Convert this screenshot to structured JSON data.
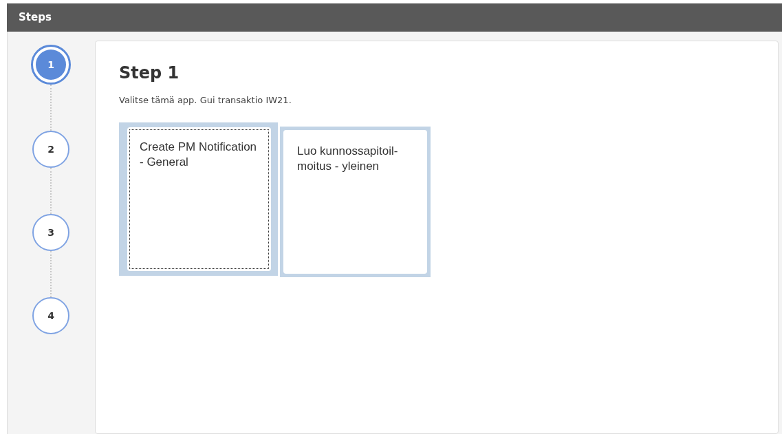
{
  "header": {
    "title": "Steps"
  },
  "steps": [
    {
      "label": "1",
      "selected": true
    },
    {
      "label": "2",
      "selected": false
    },
    {
      "label": "3",
      "selected": false
    },
    {
      "label": "4",
      "selected": false
    }
  ],
  "content": {
    "title": "Step 1",
    "description": "Valitse tämä app. Gui transaktio IW21.",
    "tiles": [
      {
        "title": "Create PM Notification - General",
        "focused": true
      },
      {
        "title": "Luo kunnossapitoil-moitus - yleinen",
        "focused": false
      }
    ]
  }
}
